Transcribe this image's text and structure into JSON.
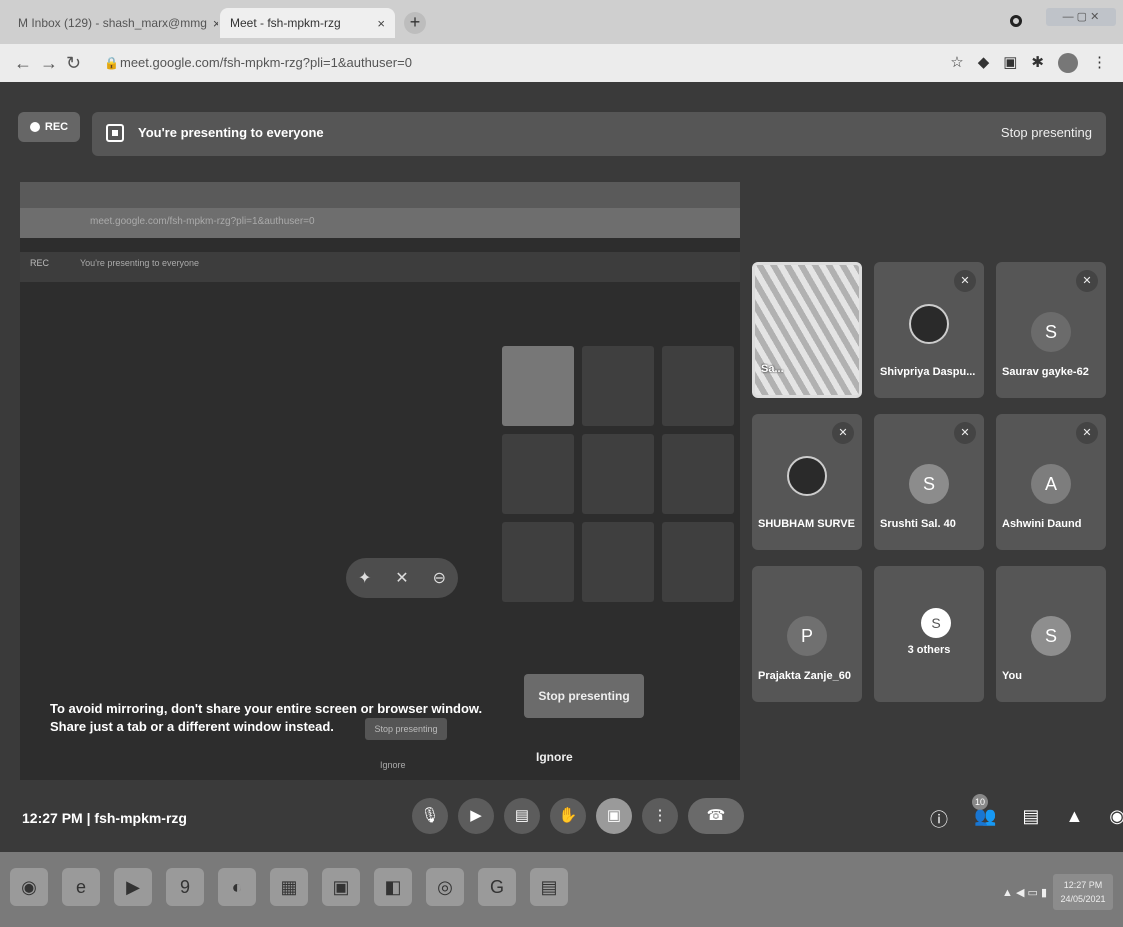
{
  "browser": {
    "tabs": [
      {
        "label": "M Inbox (129) - shash_marx@mmg",
        "close": "×"
      },
      {
        "label": "Meet - fsh-mpkm-rzg",
        "close": "×"
      }
    ],
    "new_tab": "+",
    "url": "meet.google.com/fsh-mpkm-rzg?pli=1&authuser=0"
  },
  "meet": {
    "rec_label": "REC",
    "presenting_text": "You're presenting to everyone",
    "stop_presenting_top": "Stop presenting",
    "warning_text": "To avoid mirroring, don't share your entire screen or browser window. Share just a tab or a different window instead.",
    "warning_stop": "Stop presenting",
    "warning_ignore": "Ignore",
    "participants": [
      {
        "name": "Sa...",
        "type": "screen"
      },
      {
        "name": "Shivpriya Daspu...",
        "type": "photo"
      },
      {
        "name": "Saurav gayke-62",
        "initial": "S"
      },
      {
        "name": "SHUBHAM SURVE",
        "type": "photo"
      },
      {
        "name": "Srushti Sal. 40",
        "initial": "S"
      },
      {
        "name": "Ashwini Daund",
        "initial": "A"
      },
      {
        "name": "Prajakta Zanje_60",
        "initial": "P"
      },
      {
        "name": "3 others",
        "initial": "S"
      },
      {
        "name": "You",
        "initial": "S"
      }
    ],
    "time": "12:27 PM",
    "meeting_code": "fsh-mpkm-rzg",
    "people_count": "10",
    "colors": {
      "background": "#3a3a3a",
      "tile": "#565656"
    }
  },
  "taskbar": {
    "clock_time": "12:27 PM",
    "clock_date": "24/05/2021"
  }
}
